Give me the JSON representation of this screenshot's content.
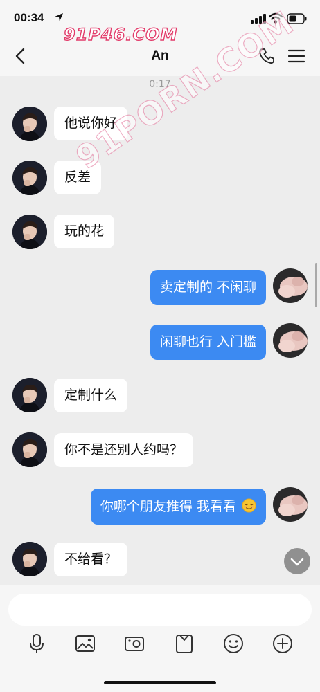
{
  "status_bar": {
    "time": "00:34"
  },
  "header": {
    "title": "An"
  },
  "watermarks": {
    "top": "91P46.COM",
    "diagonal": "91PORN.COM"
  },
  "conversation": {
    "timestamp": "0:17",
    "messages": [
      {
        "from": "them",
        "text": "他说你好"
      },
      {
        "from": "them",
        "text": "反差"
      },
      {
        "from": "them",
        "text": "玩的花"
      },
      {
        "from": "me",
        "text": "卖定制的 不闲聊"
      },
      {
        "from": "me",
        "text": "闲聊也行 入门槛"
      },
      {
        "from": "them",
        "text": "定制什么"
      },
      {
        "from": "them",
        "text": "你不是还别人约吗？"
      },
      {
        "from": "me",
        "text": "你哪个朋友推得 我看看",
        "emoji": "relieved-face"
      },
      {
        "from": "them",
        "text": "不给看？"
      }
    ]
  },
  "composer": {
    "input_value": "",
    "tools": [
      "microphone-icon",
      "image-icon",
      "camera-icon",
      "folder-icon",
      "emoji-icon",
      "plus-icon"
    ]
  },
  "colors": {
    "outgoing_bubble": "#3c8af2",
    "incoming_bubble": "#ffffff",
    "background": "#ededed",
    "watermark": "#e23b6a"
  }
}
